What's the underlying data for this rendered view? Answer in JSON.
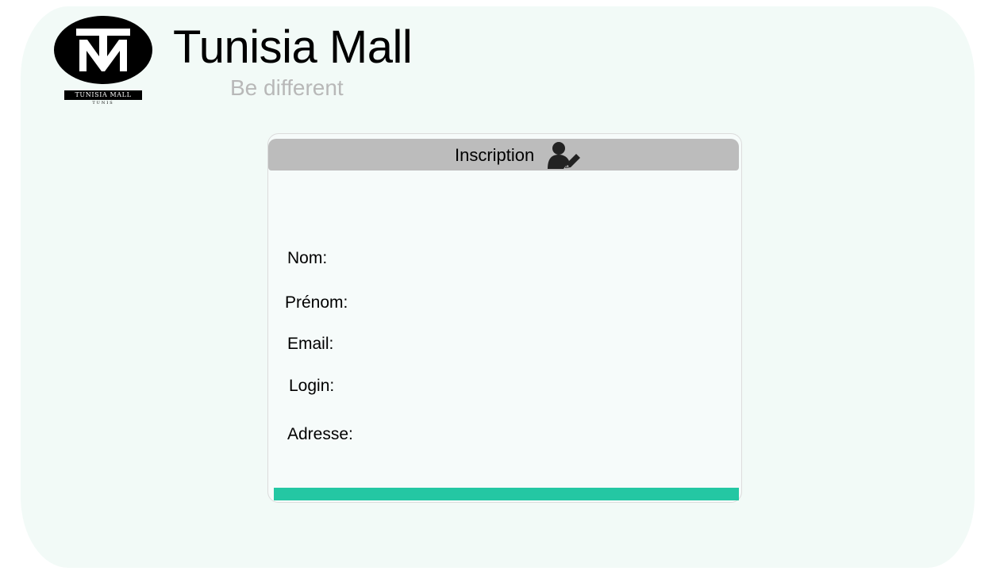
{
  "brand": {
    "name": "Tunisia Mall",
    "tagline": "Be different",
    "logo_band_text": "TUNISIA MALL",
    "logo_sub_text": "TUNIS",
    "accent_color": "#24c7a3"
  },
  "form": {
    "title": "Inscription",
    "title_icon": "user-edit-icon",
    "fields": {
      "nom": "Nom:",
      "prenom": "Prénom:",
      "email": "Email:",
      "login": "Login:",
      "adresse": "Adresse:"
    }
  }
}
